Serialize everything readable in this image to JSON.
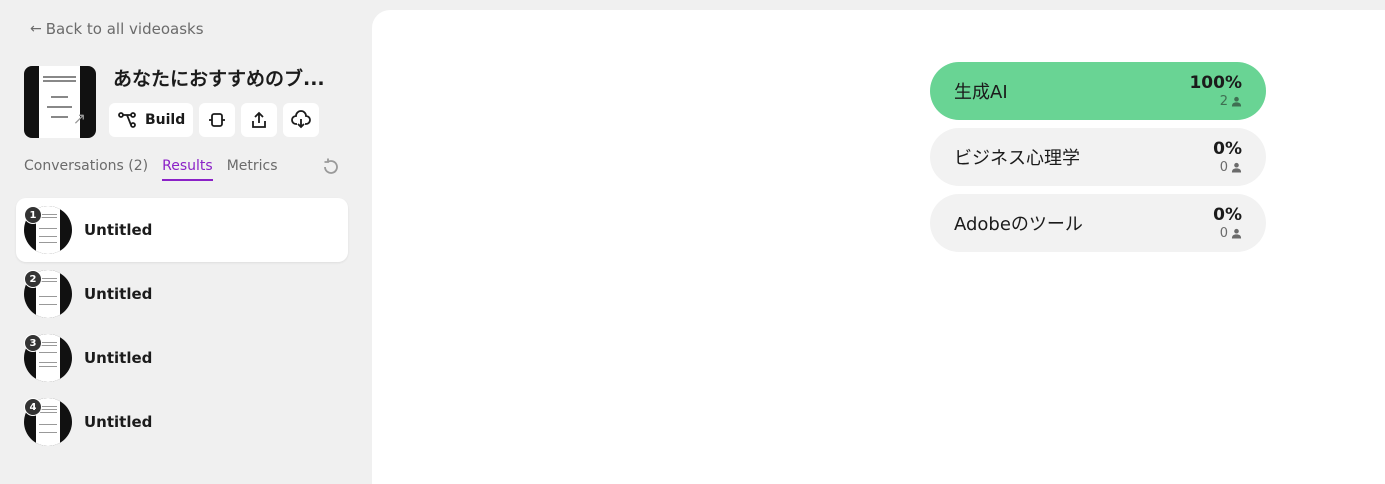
{
  "nav": {
    "back_arrow": "←",
    "back_label": "Back to all videoasks"
  },
  "project": {
    "title": "あなたにおすすめのブ..."
  },
  "toolbar": {
    "build_label": "Build",
    "icons": [
      "flow-icon",
      "settings-chip-icon",
      "share-icon",
      "cloud-download-icon"
    ]
  },
  "tabs": [
    {
      "label": "Conversations (2)",
      "active": false
    },
    {
      "label": "Results",
      "active": true
    },
    {
      "label": "Metrics",
      "active": false
    }
  ],
  "conversations": [
    {
      "number": "1",
      "label": "Untitled",
      "selected": true
    },
    {
      "number": "2",
      "label": "Untitled",
      "selected": false
    },
    {
      "number": "3",
      "label": "Untitled",
      "selected": false
    },
    {
      "number": "4",
      "label": "Untitled",
      "selected": false
    }
  ],
  "results": [
    {
      "label": "生成AI",
      "percent": "100%",
      "count": "2",
      "share": 1.0
    },
    {
      "label": "ビジネス心理学",
      "percent": "0%",
      "count": "0",
      "share": 0
    },
    {
      "label": "Adobeのツール",
      "percent": "0%",
      "count": "0",
      "share": 0
    }
  ],
  "colors": {
    "accent": "#8b21c7",
    "winner": "#69d494",
    "sidebar_bg": "#f0f0f0"
  }
}
